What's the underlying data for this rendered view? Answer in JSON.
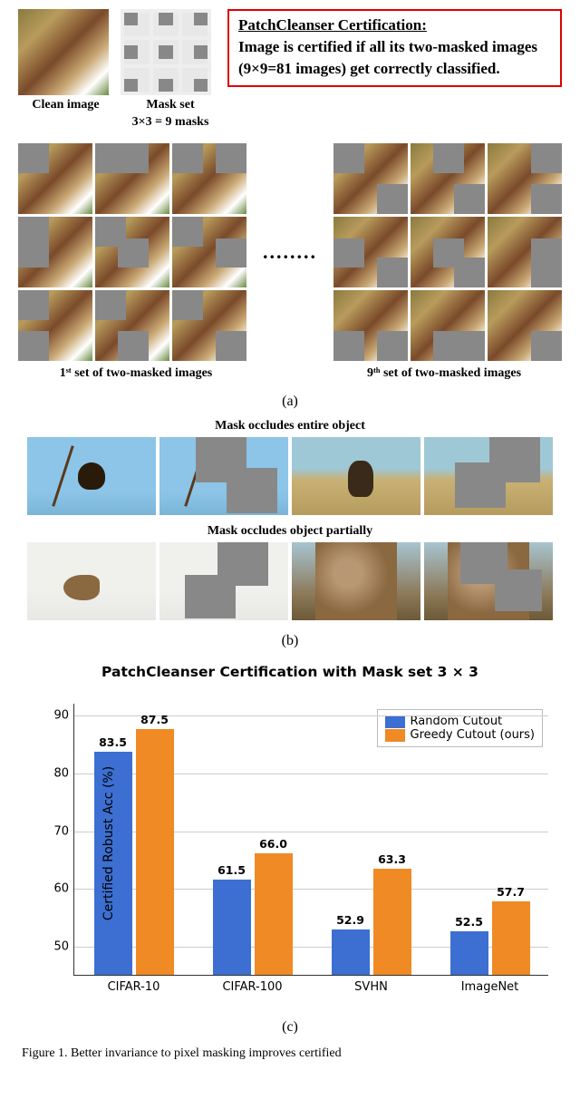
{
  "section_a": {
    "clean_caption": "Clean image",
    "mask_caption_l1": "Mask set",
    "mask_caption_l2": "3×3 = 9 masks",
    "cert_title": "PatchCleanser Certification:",
    "cert_body": "Image is certified if all its two-masked images (9×9=81 images) get correctly classified.",
    "ex1_caption": "1ˢᵗ set of two-masked images",
    "ex9_caption": "9ᵗʰ set of two-masked images",
    "dots": "........",
    "label": "(a)"
  },
  "section_b": {
    "title1": "Mask occludes entire object",
    "title2": "Mask occludes object partially",
    "label": "(b)"
  },
  "section_c": {
    "chart_title": "PatchCleanser Certification with Mask set 3 × 3",
    "legend_blue": "Random Cutout",
    "legend_orange": "Greedy Cutout (ours)",
    "ylabel": "Certified Robust Acc (%)",
    "label": "(c)"
  },
  "chart_data": {
    "type": "bar",
    "categories": [
      "CIFAR-10",
      "CIFAR-100",
      "SVHN",
      "ImageNet"
    ],
    "series": [
      {
        "name": "Random Cutout",
        "color": "#3c6fd1",
        "values": [
          83.5,
          61.5,
          52.9,
          52.5
        ]
      },
      {
        "name": "Greedy Cutout (ours)",
        "color": "#f08a24",
        "values": [
          87.5,
          66.0,
          63.3,
          57.7
        ]
      }
    ],
    "ylim": [
      45,
      92
    ],
    "yticks": [
      50,
      60,
      70,
      80,
      90
    ],
    "ylabel": "Certified Robust Acc (%)",
    "title": "PatchCleanser Certification with Mask set 3 × 3"
  },
  "figure_caption": "Figure 1. Better invariance to pixel masking improves certified"
}
